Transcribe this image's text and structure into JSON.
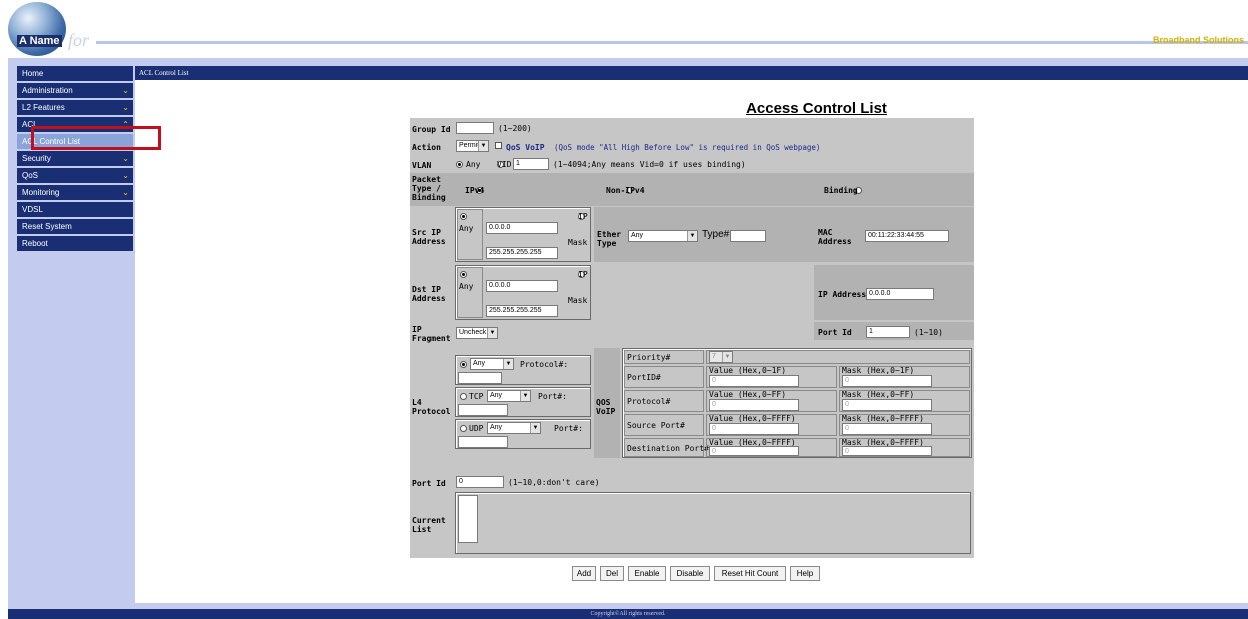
{
  "header": {
    "logo_name": "A Name",
    "logo_for": "for",
    "right_text": "Broadband Solutions"
  },
  "sidebar": {
    "items": [
      {
        "label": "Home"
      },
      {
        "label": "Administration"
      },
      {
        "label": "L2 Features"
      },
      {
        "label": "ACL"
      },
      {
        "label": "ACL Control List"
      },
      {
        "label": "Security"
      },
      {
        "label": "QoS"
      },
      {
        "label": "Monitoring"
      },
      {
        "label": "VDSL"
      },
      {
        "label": "Reset System"
      },
      {
        "label": "Reboot"
      }
    ],
    "chevron_down": "⌄",
    "chevron_up": "⌃"
  },
  "breadcrumb": "ACL Control List",
  "page_title": "Access Control List",
  "form": {
    "group_id": {
      "label": "Group Id",
      "value": "",
      "hint": "(1~200)"
    },
    "action": {
      "label": "Action",
      "value": "Permit",
      "qos_voip_label": "QoS VoIP",
      "qos_voip_note": "(QoS mode \"All High Before Low\" is required in QoS webpage)"
    },
    "vlan": {
      "label": "VLAN",
      "any_label": "Any",
      "vid_label": "VID",
      "vid_value": "1",
      "hint": "(1~4094;Any means Vid=0 if uses binding)"
    },
    "packet_type": {
      "label": "Packet Type / Binding",
      "ipv4": "IPv4",
      "non_ipv4": "Non-IPv4",
      "binding": "Binding"
    },
    "src_ip": {
      "label": "Src IP Address",
      "any_label": "Any",
      "ip_label": "IP",
      "ip_value": "0.0.0.0",
      "mask_label": "Mask",
      "mask_value": "255.255.255.255"
    },
    "dst_ip": {
      "label": "Dst IP Address",
      "any_label": "Any",
      "ip_label": "IP",
      "ip_value": "0.0.0.0",
      "mask_label": "Mask",
      "mask_value": "255.255.255.255"
    },
    "ether_type": {
      "label": "Ether Type",
      "value": "Any",
      "type_label": "Type#",
      "type_value": ""
    },
    "mac_address": {
      "label": "MAC Address",
      "value": "00:11:22:33:44:55"
    },
    "ip_address": {
      "label": "IP Address",
      "value": "0.0.0.0"
    },
    "port_id_binding": {
      "label": "Port Id",
      "value": "1",
      "hint": "(1~10)"
    },
    "ip_fragment": {
      "label": "IP Fragment",
      "value": "Uncheck"
    },
    "l4_protocol": {
      "label": "L4 Protocol",
      "any_value": "Any",
      "protocol_label": "Protocol#:",
      "tcp_label": "TCP",
      "tcp_value": "Any",
      "udp_label": "UDP",
      "udp_value": "Any",
      "port_label": "Port#:"
    },
    "qos_voip": {
      "label": "QOS VoIP",
      "priority_label": "Priority#",
      "priority_value": "7",
      "rows": [
        {
          "label": "PortID#",
          "value_header": "Value (Hex,0~1F)",
          "mask_header": "Mask (Hex,0~1F)",
          "value": "0",
          "mask": "0"
        },
        {
          "label": "Protocol#",
          "value_header": "Value (Hex,0~FF)",
          "mask_header": "Mask (Hex,0~FF)",
          "value": "0",
          "mask": "0"
        },
        {
          "label": "Source Port#",
          "value_header": "Value (Hex,0~FFFF)",
          "mask_header": "Mask (Hex,0~FFFF)",
          "value": "0",
          "mask": "0"
        },
        {
          "label": "Destination Port#",
          "value_header": "Value (Hex,0~FFFF)",
          "mask_header": "Mask (Hex,0~FFFF)",
          "value": "0",
          "mask": "0"
        }
      ]
    },
    "port_id": {
      "label": "Port Id",
      "value": "0",
      "hint": "(1~10,0:don't care)"
    },
    "current_list": {
      "label": "Current List"
    }
  },
  "buttons": {
    "add": "Add",
    "del": "Del",
    "enable": "Enable",
    "disable": "Disable",
    "reset_hit_count": "Reset Hit Count",
    "help": "Help"
  },
  "footer": "Copyright©All rights reserved.",
  "colors": {
    "nav_bg": "#1a2f73",
    "nav_active": "#8aa4d9",
    "frame_bg": "#c3ccef",
    "form_bg": "#c6c6c6",
    "highlight": "#c0101c"
  }
}
